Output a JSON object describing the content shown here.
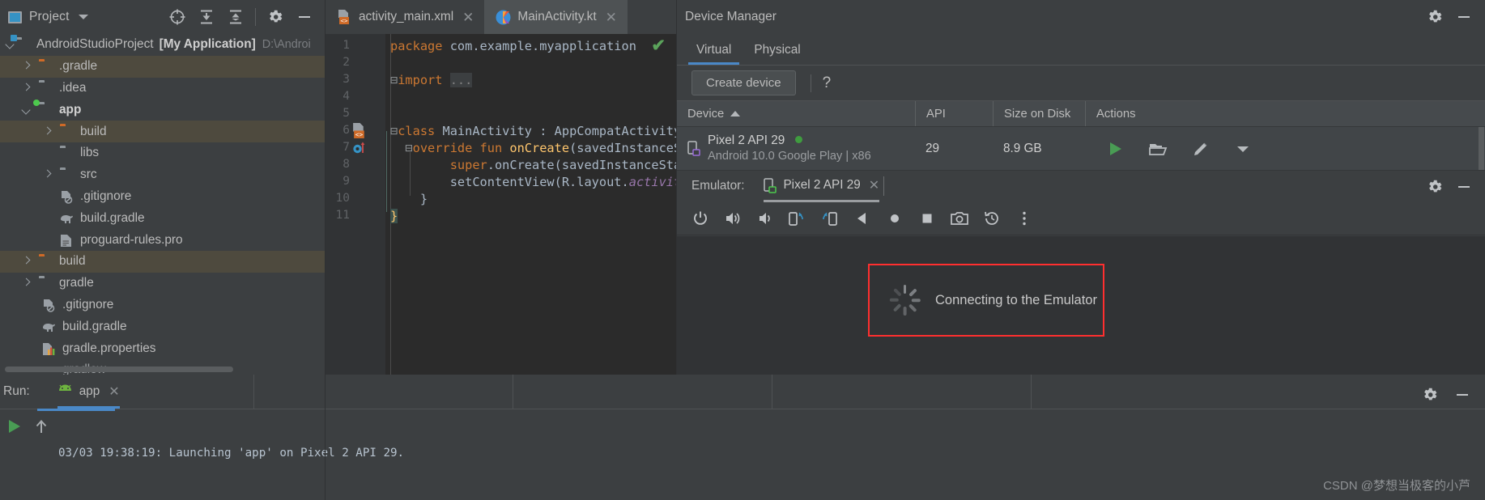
{
  "project_panel": {
    "title": "Project",
    "icons": [
      "project-view-icon",
      "locate-icon",
      "collapse-all-icon",
      "expand-all-icon",
      "settings-gear-icon",
      "minimize-icon"
    ],
    "tree": [
      {
        "label": "AndroidStudioProject",
        "bold_suffix": "[My Application]",
        "path": "D:\\Androi",
        "arrow": "down",
        "icon": "folder-module",
        "indent": 0,
        "selected": false
      },
      {
        "label": ".gradle",
        "arrow": "right",
        "icon": "folder-orange",
        "indent": 1,
        "selected": true
      },
      {
        "label": ".idea",
        "arrow": "right",
        "icon": "folder-grey",
        "indent": 1,
        "selected": false
      },
      {
        "label": "app",
        "arrow": "down",
        "icon": "folder-module-green",
        "indent": 1,
        "selected": false,
        "bold": true
      },
      {
        "label": "build",
        "arrow": "right",
        "icon": "folder-orange",
        "indent": 2,
        "selected": true
      },
      {
        "label": "libs",
        "arrow": "none",
        "icon": "folder-grey",
        "indent": 2,
        "selected": false
      },
      {
        "label": "src",
        "arrow": "right",
        "icon": "folder-grey",
        "indent": 2,
        "selected": false
      },
      {
        "label": ".gitignore",
        "arrow": "none",
        "icon": "gitignore-file-icon",
        "indent": 3,
        "selected": false
      },
      {
        "label": "build.gradle",
        "arrow": "none",
        "icon": "gradle-elephant-icon",
        "indent": 3,
        "selected": false
      },
      {
        "label": "proguard-rules.pro",
        "arrow": "none",
        "icon": "text-file-icon",
        "indent": 3,
        "selected": false
      },
      {
        "label": "build",
        "arrow": "right",
        "icon": "folder-orange",
        "indent": 1,
        "selected": true
      },
      {
        "label": "gradle",
        "arrow": "right",
        "icon": "folder-grey",
        "indent": 1,
        "selected": false
      },
      {
        "label": ".gitignore",
        "arrow": "none",
        "icon": "gitignore-file-icon",
        "indent": 2,
        "selected": false
      },
      {
        "label": "build.gradle",
        "arrow": "none",
        "icon": "gradle-elephant-icon",
        "indent": 2,
        "selected": false
      },
      {
        "label": "gradle.properties",
        "arrow": "none",
        "icon": "properties-file-icon",
        "indent": 2,
        "selected": false
      },
      {
        "label": "gradlew",
        "arrow": "none",
        "icon": "file-icon",
        "indent": 2,
        "selected": false
      }
    ]
  },
  "editor": {
    "tabs": [
      {
        "label": "activity_main.xml",
        "icon": "xml-layout-icon",
        "active": false,
        "closable": true
      },
      {
        "label": "MainActivity.kt",
        "icon": "kotlin-icon",
        "active": true,
        "closable": true
      }
    ],
    "line_numbers": [
      "1",
      "2",
      "3",
      "4",
      "5",
      "6",
      "7",
      "8",
      "9",
      "10",
      "11"
    ],
    "code_lines": [
      "package com.example.myapplication",
      "",
      "import ...",
      "",
      "",
      "class MainActivity : AppCompatActivity() {",
      "    override fun onCreate(savedInstanceSta",
      "        super.onCreate(savedInstanceState)",
      "        setContentView(R.layout.activity_m",
      "    }",
      "}"
    ],
    "inspection_status": "ok-checkmark"
  },
  "device_manager": {
    "title": "Device Manager",
    "tabs": [
      {
        "label": "Virtual",
        "active": true
      },
      {
        "label": "Physical",
        "active": false
      }
    ],
    "create_device_label": "Create device",
    "help_label": "?",
    "columns": [
      "Device",
      "API",
      "Size on Disk",
      "Actions"
    ],
    "sort_column": "Device",
    "sort_direction": "asc",
    "rows": [
      {
        "device_name": "Pixel 2 API 29",
        "device_detail": "Android 10.0 Google Play | x86",
        "status": "online",
        "api": "29",
        "size_on_disk": "8.9 GB",
        "actions": [
          "run-icon",
          "folder-open-icon",
          "edit-pencil-icon",
          "dropdown-chevron-icon"
        ]
      }
    ]
  },
  "emulator": {
    "label": "Emulator:",
    "tab_label": "Pixel 2 API 29",
    "toolbar_icons": [
      "power-icon",
      "volume-up-icon",
      "volume-down-icon",
      "rotate-left-icon",
      "rotate-right-icon",
      "back-icon",
      "home-icon",
      "overview-icon",
      "screenshot-icon",
      "history-icon",
      "more-vertical-icon"
    ],
    "connecting_text": "Connecting to the Emulator",
    "highlight_color": "#ff2f2f"
  },
  "run_panel": {
    "label": "Run:",
    "tab_label": "app",
    "console_text": "03/03 19:38:19: Launching 'app' on Pixel 2 API 29.",
    "icons": [
      "run-play-icon",
      "jump-to-source-icon",
      "settings-gear-icon",
      "minimize-icon"
    ]
  },
  "watermark": "CSDN @梦想当极客的小芦",
  "colors": {
    "accent_blue": "#4a88c7",
    "selection": "#4e4a3e",
    "folder_orange": "#cf6a27",
    "status_green": "#3f9c3f",
    "highlight_red": "#ff2f2f",
    "editor_bg": "#2b2b2b",
    "panel_bg": "#3c3f41"
  }
}
